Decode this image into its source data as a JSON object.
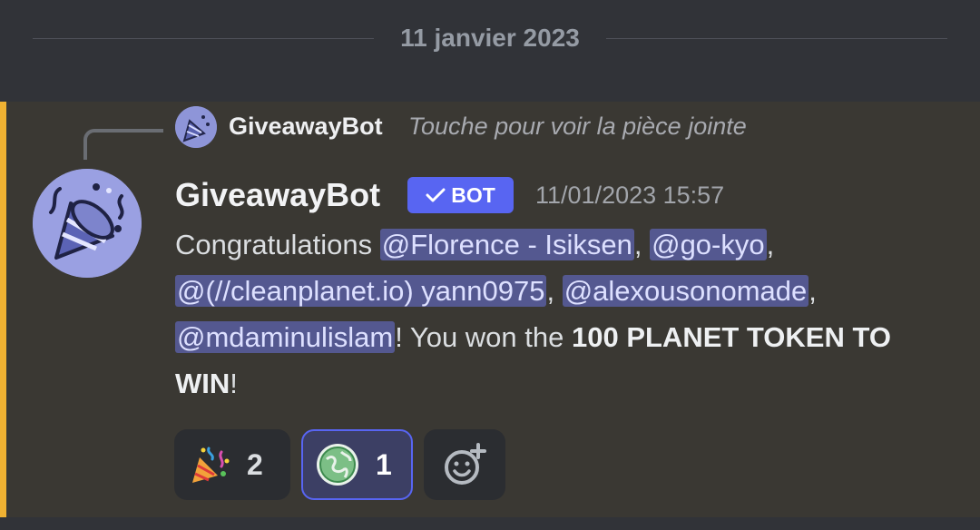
{
  "date_divider": "11 janvier 2023",
  "reply": {
    "author": "GiveawayBot",
    "preview": "Touche pour voir la pièce jointe"
  },
  "message": {
    "author": "GiveawayBot",
    "bot_tag": "BOT",
    "timestamp": "11/01/2023 15:57",
    "segments": {
      "s1": "Congratulations ",
      "m1": "@Florence - Isiksen",
      "s2": ", ",
      "m2": "@go-kyo",
      "s3": ", ",
      "m3": "@(//cleanplanet.io) yann0975",
      "s4": ", ",
      "m4": "@alexousonomade",
      "s5": ", ",
      "m5": "@mdaminulislam",
      "s6": "! You won the ",
      "b1": "100 PLANET TOKEN TO WIN",
      "s7": "!"
    }
  },
  "reactions": [
    {
      "emoji": "party-popper-icon",
      "count": "2",
      "selected": false
    },
    {
      "emoji": "planet-token-icon",
      "count": "1",
      "selected": true
    },
    {
      "emoji": "add-reaction-icon"
    }
  ],
  "colors": {
    "background": "#313338",
    "message_highlight": "#3a3833",
    "accent_bar": "#f0b232",
    "bot_tag": "#5865f2",
    "mention_bg": "#545890"
  }
}
